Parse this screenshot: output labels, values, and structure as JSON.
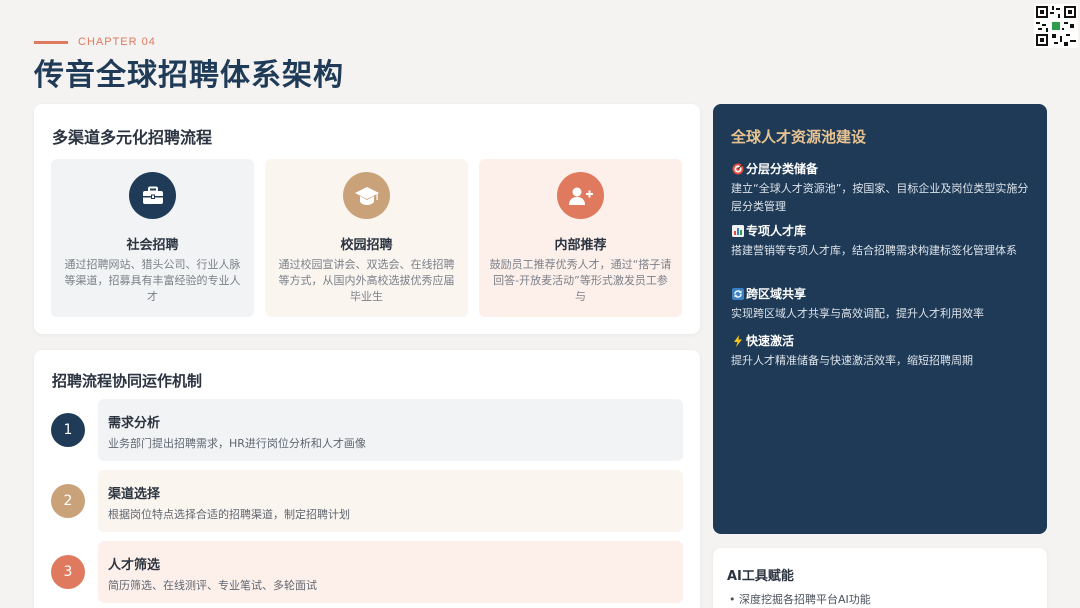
{
  "header": {
    "chapter": "CHAPTER 04",
    "title": "传音全球招聘体系架构"
  },
  "channels": {
    "title": "多渠道多元化招聘流程",
    "items": [
      {
        "name": "社会招聘",
        "desc": "通过招聘网站、猎头公司、行业人脉等渠道，招募具有丰富经验的专业人才",
        "icon": "briefcase-icon",
        "icon_bg": "#1f3b57",
        "card_bg": "#f1f3f5"
      },
      {
        "name": "校园招聘",
        "desc": "通过校园宣讲会、双选会、在线招聘等方式，从国内外高校选拔优秀应届毕业生",
        "icon": "graduation-cap-icon",
        "icon_bg": "#c9a27a",
        "card_bg": "#faf5ef"
      },
      {
        "name": "内部推荐",
        "desc": "鼓励员工推荐优秀人才，通过“搭子请回答-开放麦活动”等形式激发员工参与",
        "icon": "user-plus-icon",
        "icon_bg": "#e07a5f",
        "card_bg": "#fdf0eb"
      }
    ]
  },
  "process": {
    "title": "招聘流程协同运作机制",
    "steps": [
      {
        "num": "1",
        "title": "需求分析",
        "desc": "业务部门提出招聘需求，HR进行岗位分析和人才画像",
        "num_bg": "#1f3b57",
        "box_bg": "#f1f3f5"
      },
      {
        "num": "2",
        "title": "渠道选择",
        "desc": "根据岗位特点选择合适的招聘渠道，制定招聘计划",
        "num_bg": "#c9a27a",
        "box_bg": "#faf5ef"
      },
      {
        "num": "3",
        "title": "人才筛选",
        "desc": "简历筛选、在线测评、专业笔试、多轮面试",
        "num_bg": "#e07a5f",
        "box_bg": "#fdf0eb"
      }
    ]
  },
  "pool": {
    "title": "全球人才资源池建设",
    "items": [
      {
        "title": "分层分类储备",
        "desc": "建立“全球人才资源池”，按国家、目标企业及岗位类型实施分层分类管理",
        "icon": "target-icon"
      },
      {
        "title": "专项人才库",
        "desc": "搭建营销等专项人才库，结合招聘需求构建标签化管理体系",
        "icon": "bar-chart-icon"
      },
      {
        "title": "跨区域共享",
        "desc": "实现跨区域人才共享与高效调配，提升人才利用效率",
        "icon": "refresh-icon"
      },
      {
        "title": "快速激活",
        "desc": "提升人才精准储备与快速激活效率，缩短招聘周期",
        "icon": "lightning-icon"
      }
    ]
  },
  "ai": {
    "title": "AI工具赋能",
    "items": [
      "深度挖掘各招聘平台AI功能"
    ]
  },
  "colors": {
    "navy": "#1f3b57",
    "gold": "#c9a27a",
    "coral": "#e07a5f",
    "pool_title": "#e8c391"
  }
}
